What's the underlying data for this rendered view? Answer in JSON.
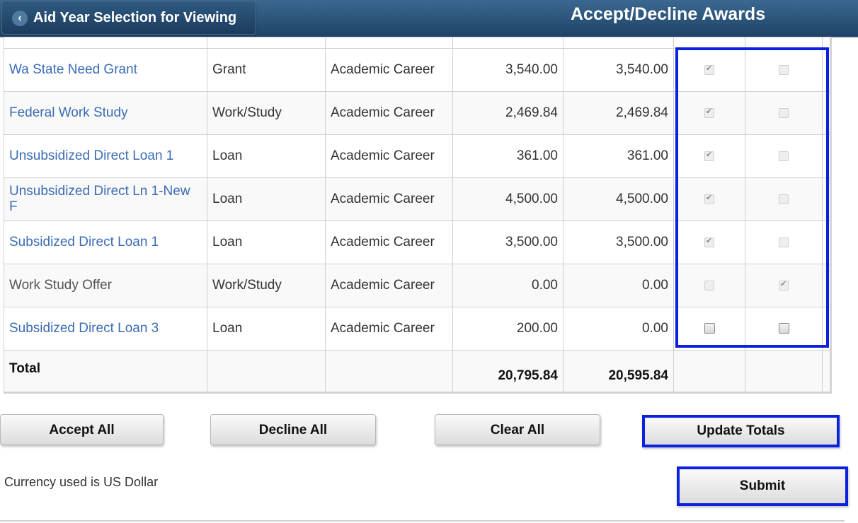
{
  "header": {
    "back_label": "Aid Year Selection for Viewing",
    "back_icon": "chevron-left-icon",
    "title": "Accept/Decline Awards"
  },
  "awards": [
    {
      "name": "Wa State Need Grant",
      "linked": true,
      "type": "Grant",
      "career": "Academic Career",
      "offered": "3,540.00",
      "accepted": "3,540.00",
      "accept_checked": true,
      "decline_checked": false,
      "editable": false
    },
    {
      "name": "Federal Work Study",
      "linked": true,
      "type": "Work/Study",
      "career": "Academic Career",
      "offered": "2,469.84",
      "accepted": "2,469.84",
      "accept_checked": true,
      "decline_checked": false,
      "editable": false
    },
    {
      "name": "Unsubsidized Direct Loan 1",
      "linked": true,
      "type": "Loan",
      "career": "Academic Career",
      "offered": "361.00",
      "accepted": "361.00",
      "accept_checked": true,
      "decline_checked": false,
      "editable": false
    },
    {
      "name": "Unsubsidized Direct Ln 1-New F",
      "linked": true,
      "type": "Loan",
      "career": "Academic Career",
      "offered": "4,500.00",
      "accepted": "4,500.00",
      "accept_checked": true,
      "decline_checked": false,
      "editable": false
    },
    {
      "name": "Subsidized Direct Loan 1",
      "linked": true,
      "type": "Loan",
      "career": "Academic Career",
      "offered": "3,500.00",
      "accepted": "3,500.00",
      "accept_checked": true,
      "decline_checked": false,
      "editable": false
    },
    {
      "name": "Work Study Offer",
      "linked": false,
      "type": "Work/Study",
      "career": "Academic Career",
      "offered": "0.00",
      "accepted": "0.00",
      "accept_checked": false,
      "decline_checked": true,
      "editable": false
    },
    {
      "name": "Subsidized Direct Loan 3",
      "linked": true,
      "type": "Loan",
      "career": "Academic Career",
      "offered": "200.00",
      "accepted": "0.00",
      "accept_checked": false,
      "decline_checked": false,
      "editable": true
    }
  ],
  "total": {
    "label": "Total",
    "offered": "20,795.84",
    "accepted": "20,595.84"
  },
  "buttons": {
    "accept_all": "Accept All",
    "decline_all": "Decline All",
    "clear_all": "Clear All",
    "update_totals": "Update Totals",
    "submit": "Submit"
  },
  "currency_note": "Currency used is US Dollar",
  "colors": {
    "header_bg": "#2a5178",
    "link": "#3a6bb5",
    "highlight": "#0a22e0"
  }
}
